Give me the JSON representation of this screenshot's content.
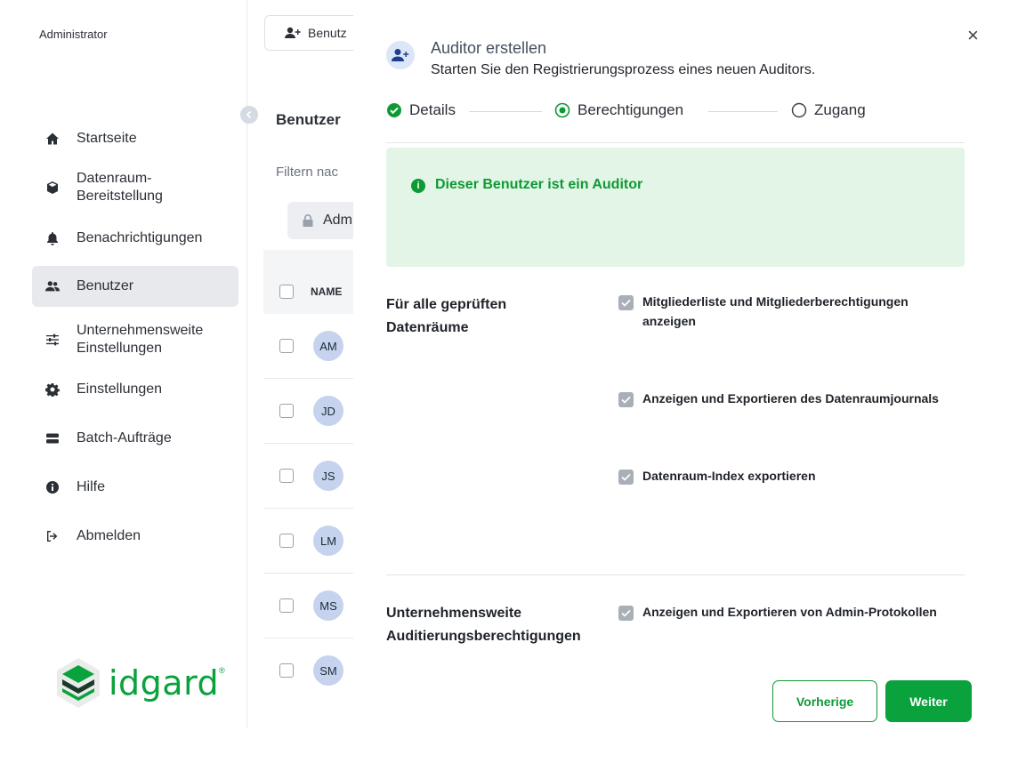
{
  "colors": {
    "brand_green": "#0aa23c",
    "alert_bg": "#e3f5e6",
    "active_nav_bg": "#e7e9ed",
    "avatar_bg": "#c5d3ee"
  },
  "sidebar": {
    "role": "Administrator",
    "items": [
      {
        "label": "Startseite",
        "icon": "home-icon"
      },
      {
        "label": "Datenraum-\nBereitstellung",
        "icon": "cube-icon"
      },
      {
        "label": "Benachrichtigungen",
        "icon": "bell-icon"
      },
      {
        "label": "Benutzer",
        "icon": "users-icon",
        "active": true
      },
      {
        "label": "Unternehmensweite\nEinstellungen",
        "icon": "sliders-icon"
      },
      {
        "label": "Einstellungen",
        "icon": "gear-icon"
      },
      {
        "label": "Batch-Aufträge",
        "icon": "server-icon"
      },
      {
        "label": "Hilfe",
        "icon": "info-icon"
      },
      {
        "label": "Abmelden",
        "icon": "logout-icon"
      }
    ],
    "logo": {
      "text": "idgard",
      "reg": "®"
    }
  },
  "middle": {
    "top_button": "Benutz",
    "title": "Benutzer",
    "filter": "Filtern nac",
    "chip": "Adm",
    "column_name": "NAME",
    "rows": [
      "AM",
      "JD",
      "JS",
      "LM",
      "MS",
      "SM"
    ]
  },
  "modal": {
    "title": "Auditor erstellen",
    "subtitle": "Starten Sie den Registrierungsprozess eines neuen Auditors.",
    "close": "×",
    "steps": [
      {
        "label": "Details",
        "state": "done"
      },
      {
        "label": "Berechtigungen",
        "state": "current"
      },
      {
        "label": "Zugang",
        "state": "todo"
      }
    ],
    "alert": "Dieser Benutzer ist ein Auditor",
    "section1": {
      "label": "Für alle geprüften\nDatenräume",
      "permissions": [
        "Mitgliederliste und Mitgliederberechtigungen\nanzeigen",
        "Anzeigen und Exportieren des Datenraumjournals",
        "Datenraum-Index exportieren"
      ]
    },
    "section2": {
      "label": "Unternehmensweite\nAuditierungsberechtigungen",
      "permissions": [
        "Anzeigen und Exportieren von Admin-Protokollen"
      ]
    },
    "buttons": {
      "prev": "Vorherige",
      "next": "Weiter"
    }
  }
}
